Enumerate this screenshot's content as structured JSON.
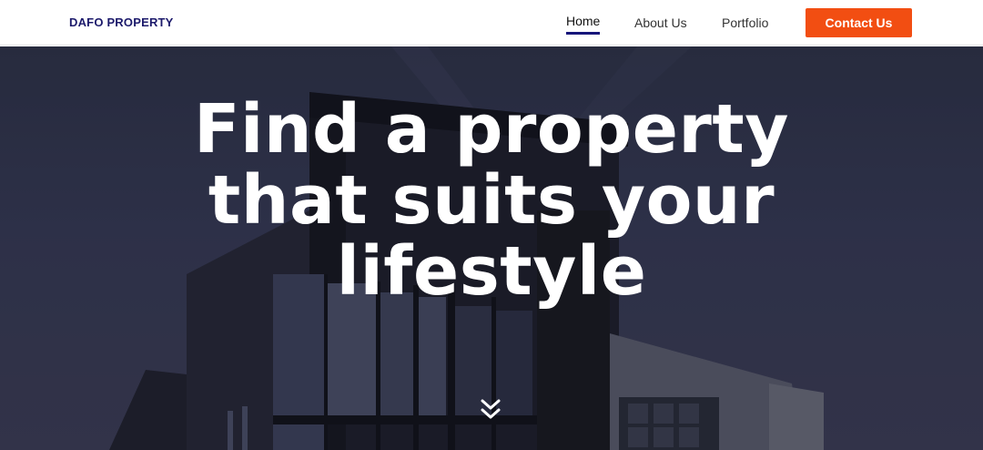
{
  "navbar": {
    "brand": "DAFO PROPERTY",
    "links": [
      {
        "label": "Home",
        "active": true
      },
      {
        "label": "About Us",
        "active": false
      },
      {
        "label": "Portfolio",
        "active": false
      }
    ],
    "cta_label": "Contact Us"
  },
  "hero": {
    "title": "Find a property that suits your lifestyle",
    "scroll_icon": "double-chevron-down-icon"
  },
  "colors": {
    "brand_text": "#1c1a6b",
    "active_underline": "#16157a",
    "cta_background": "#f24e12",
    "hero_overlay": "#2b2f43"
  }
}
